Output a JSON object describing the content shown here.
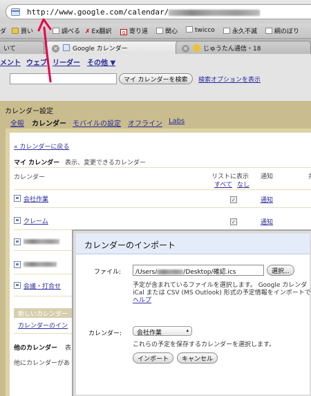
{
  "browser": {
    "url": "http://www.google.com/calendar/",
    "bookmarks": [
      "ダ",
      "買い",
      "調べる",
      "Ex翻訳",
      "寄り道",
      "関心",
      "twicco",
      "永久不滅",
      "綱のぼり"
    ],
    "tabs": [
      {
        "label": "いて"
      },
      {
        "label": "Google カレンダー"
      },
      {
        "label": "じゅうたん通信・18"
      }
    ]
  },
  "gnav": [
    "メント",
    "ウェブ",
    "リーダー",
    "その他 ▼"
  ],
  "search": {
    "button": "マイ カレンダーを検索",
    "options_link": "検索オプションを表示"
  },
  "settings": {
    "title": "カレンダー設定",
    "tabs": [
      "全般",
      "カレンダー",
      "モバイルの設定",
      "オフライン",
      "Labs"
    ],
    "back_link": "« カレンダーに戻る",
    "my_calendars_label": "マイ カレンダー",
    "my_calendars_desc": "表示、変更できるカレンダー",
    "col_calendar": "カレンダー",
    "col_show_in_list": "リストに表示",
    "col_all": "すべて",
    "col_none": "なし",
    "col_notify": "通知",
    "col_extra": "共",
    "rows": [
      {
        "name": "会社作業",
        "checked": true,
        "notify": "通知"
      },
      {
        "name": "クレーム",
        "checked": true,
        "notify": "通知"
      },
      {
        "name": "",
        "checked": false,
        "notify": ""
      },
      {
        "name": "",
        "checked": false,
        "notify": ""
      },
      {
        "name": "会議・打合せ",
        "checked": false,
        "notify": ""
      }
    ],
    "new_calendar_tag": "新しいカレンダー",
    "import_link": "カレンダーのイン",
    "other_calendars_label": "他のカレンダー",
    "other_calendars_desc": "表",
    "other_calendars_note": "他にカレンダーがあ"
  },
  "modal": {
    "title": "カレンダーのインポート",
    "file_label": "ファイル:",
    "file_path_start": "/Users/",
    "file_path_end": "/Desktop/確認.ics",
    "choose_button": "選択...",
    "file_help_1": "予定が含まれているファイルを選択します。 Google カレンダ",
    "file_help_2": "iCal または CSV (MS Outlook) 形式の予定情報をインポートで",
    "help_link": "ヘルプ",
    "calendar_label": "カレンダー:",
    "calendar_selected": "会社作業",
    "calendar_help": "これらの予定を保存するカレンダーを選択します。",
    "import_button": "インポート",
    "cancel_button": "キャンセル"
  },
  "colors": {
    "annotation_arrow": "#e8004a",
    "settings_bg": "#c9bd8f",
    "link": "#2a2aa0"
  }
}
